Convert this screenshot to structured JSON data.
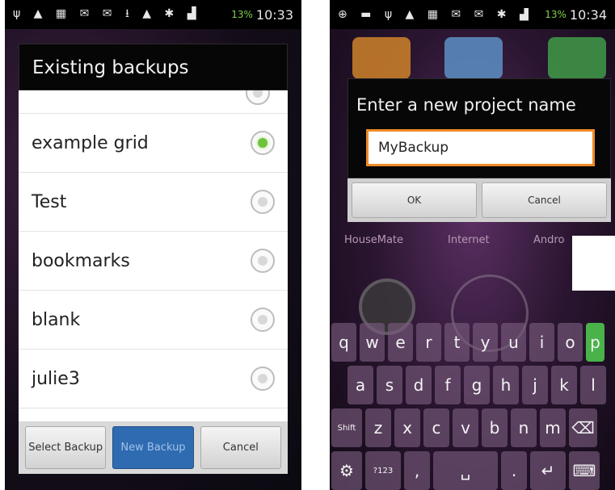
{
  "left_screen": {
    "status": {
      "time": "10:33",
      "battery": "13%"
    },
    "dialog": {
      "title": "Existing backups",
      "items": [
        {
          "label": "example grid",
          "selected": true
        },
        {
          "label": "Test",
          "selected": false
        },
        {
          "label": "bookmarks",
          "selected": false
        },
        {
          "label": "blank",
          "selected": false
        },
        {
          "label": "julie3",
          "selected": false
        }
      ],
      "buttons": {
        "select": "Select Backup",
        "new": "New Backup",
        "cancel": "Cancel"
      }
    }
  },
  "right_screen": {
    "status": {
      "time": "10:34",
      "battery": "13%"
    },
    "dialog": {
      "title": "Enter a new project name",
      "input_value": "MyBackup",
      "buttons": {
        "ok": "OK",
        "cancel": "Cancel"
      }
    },
    "home_labels": [
      "HouseMate",
      "Internet",
      "Andro"
    ],
    "keyboard": {
      "row1": [
        "q",
        "w",
        "e",
        "r",
        "t",
        "y",
        "u",
        "i",
        "o",
        "p"
      ],
      "row2": [
        "a",
        "s",
        "d",
        "f",
        "g",
        "h",
        "j",
        "k",
        "l"
      ],
      "row3": [
        "Shift",
        "z",
        "x",
        "c",
        "v",
        "b",
        "n",
        "m",
        "⌫"
      ],
      "row4": [
        "⚙",
        "?123",
        ",",
        "␣",
        ".",
        "↵",
        "⌨"
      ]
    }
  },
  "colors": {
    "accent_green": "#6fc23a",
    "input_border": "#f08a25",
    "primary_button": "#2f6bb0"
  }
}
